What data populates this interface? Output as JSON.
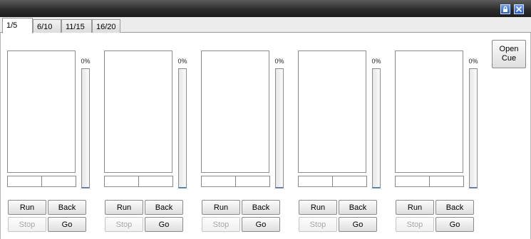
{
  "window": {
    "lock_icon": "lock-icon",
    "close_icon": "close-x-icon",
    "accent_color": "#2d5bc4"
  },
  "tabs": [
    {
      "label": "1/5",
      "active": true
    },
    {
      "label": "6/10",
      "active": false
    },
    {
      "label": "11/15",
      "active": false
    },
    {
      "label": "16/20",
      "active": false
    }
  ],
  "open_cue_label": "Open\nCue",
  "channels": [
    {
      "progress_label": "0%",
      "progress": 0,
      "run_label": "Run",
      "back_label": "Back",
      "stop_label": "Stop",
      "stop_enabled": false,
      "go_label": "Go"
    },
    {
      "progress_label": "0%",
      "progress": 0,
      "run_label": "Run",
      "back_label": "Back",
      "stop_label": "Stop",
      "stop_enabled": false,
      "go_label": "Go"
    },
    {
      "progress_label": "0%",
      "progress": 0,
      "run_label": "Run",
      "back_label": "Back",
      "stop_label": "Stop",
      "stop_enabled": false,
      "go_label": "Go"
    },
    {
      "progress_label": "0%",
      "progress": 0,
      "run_label": "Run",
      "back_label": "Back",
      "stop_label": "Stop",
      "stop_enabled": false,
      "go_label": "Go"
    },
    {
      "progress_label": "0%",
      "progress": 0,
      "run_label": "Run",
      "back_label": "Back",
      "stop_label": "Stop",
      "stop_enabled": false,
      "go_label": "Go"
    }
  ]
}
